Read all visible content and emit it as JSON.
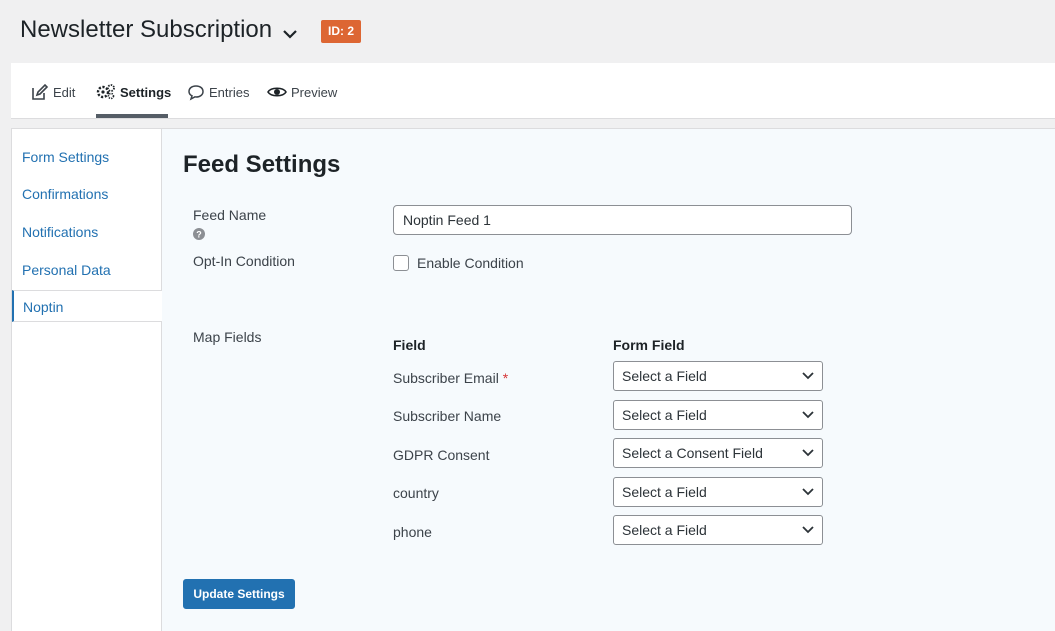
{
  "header": {
    "form_title": "Newsletter Subscription",
    "id_badge": "ID: 2"
  },
  "toolbar": {
    "edit": "Edit",
    "settings": "Settings",
    "entries": "Entries",
    "preview": "Preview"
  },
  "sidebar": {
    "items": [
      {
        "label": "Form Settings"
      },
      {
        "label": "Confirmations"
      },
      {
        "label": "Notifications"
      },
      {
        "label": "Personal Data"
      },
      {
        "label": "Noptin"
      }
    ]
  },
  "main": {
    "heading": "Feed Settings",
    "feed_name_label": "Feed Name",
    "feed_name_value": "Noptin Feed 1",
    "opt_in_label": "Opt-In Condition",
    "enable_condition_label": "Enable Condition",
    "map_fields_label": "Map Fields",
    "col_field": "Field",
    "col_form_field": "Form Field",
    "mappings": [
      {
        "field": "Subscriber Email",
        "required_mark": "*",
        "select": "Select a Field"
      },
      {
        "field": "Subscriber Name",
        "select": "Select a Field"
      },
      {
        "field": "GDPR Consent",
        "select": "Select a Consent Field"
      },
      {
        "field": "country",
        "select": "Select a Field"
      },
      {
        "field": "phone",
        "select": "Select a Field"
      }
    ],
    "update_button": "Update Settings"
  },
  "colors": {
    "accent": "#2271b1",
    "badge": "#dd6633",
    "required": "#d63638"
  }
}
